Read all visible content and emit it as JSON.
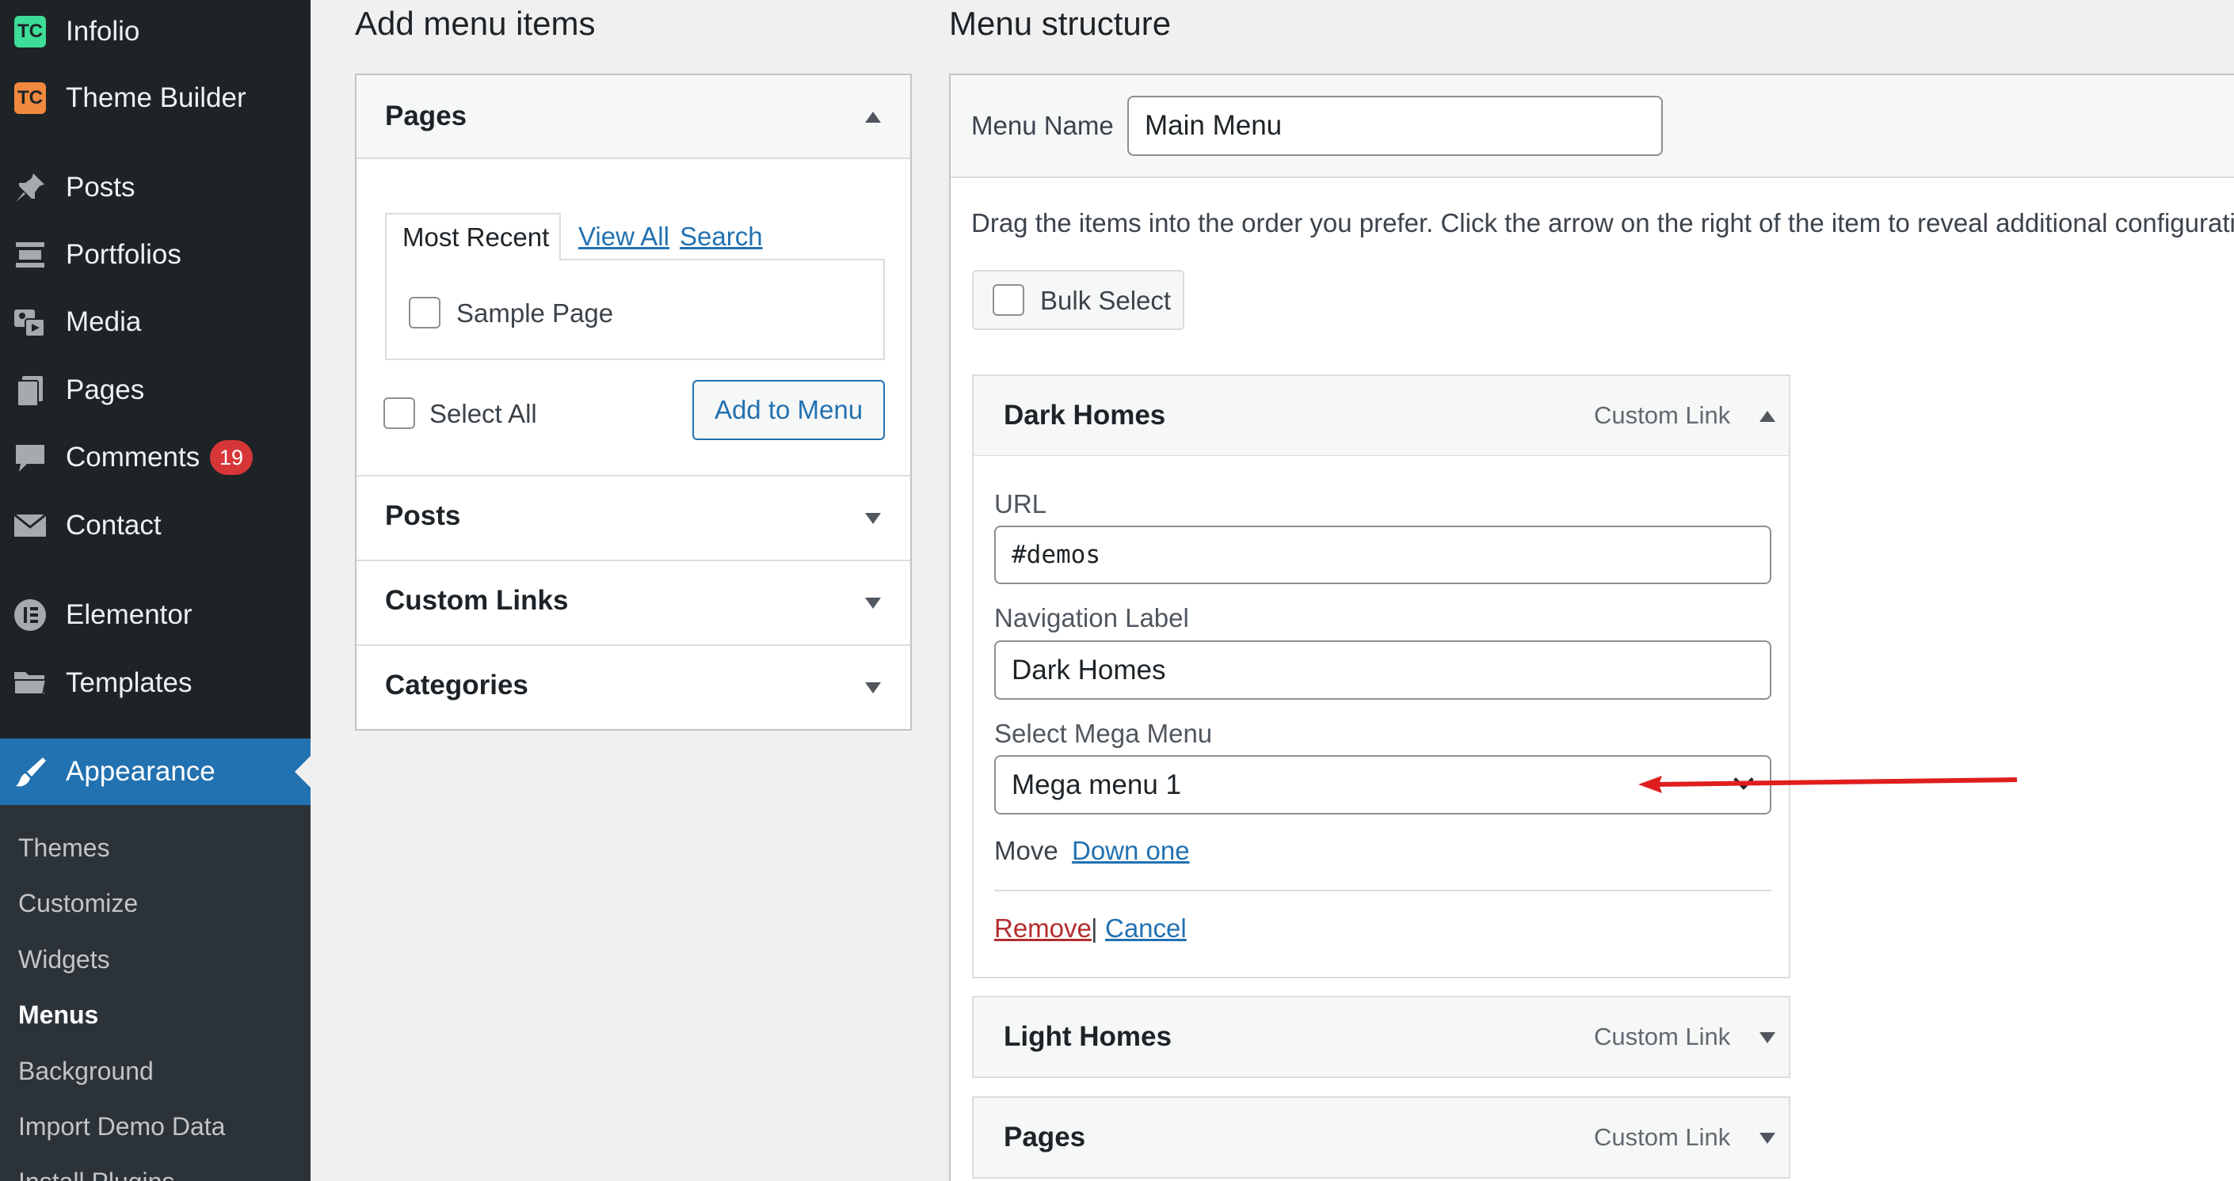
{
  "sidebar": {
    "top_items": [
      {
        "label": "Infolio",
        "icon": "tc-infolio-icon",
        "badge_text": "TC",
        "badge_color": "#3ddc97"
      },
      {
        "label": "Theme Builder",
        "icon": "tc-theme-builder-icon",
        "badge_text": "TC",
        "badge_color": "#f0883e"
      }
    ],
    "items": [
      {
        "label": "Posts",
        "icon": "pin-icon"
      },
      {
        "label": "Portfolios",
        "icon": "portfolio-icon"
      },
      {
        "label": "Media",
        "icon": "media-icon"
      },
      {
        "label": "Pages",
        "icon": "pages-icon"
      },
      {
        "label": "Comments",
        "icon": "comments-icon",
        "count": "19"
      },
      {
        "label": "Contact",
        "icon": "envelope-icon"
      },
      {
        "label": "Elementor",
        "icon": "elementor-icon"
      },
      {
        "label": "Templates",
        "icon": "folder-icon"
      }
    ],
    "active_item": {
      "label": "Appearance",
      "icon": "paintbrush-icon"
    },
    "submenu": [
      {
        "label": "Themes"
      },
      {
        "label": "Customize"
      },
      {
        "label": "Widgets"
      },
      {
        "label": "Menus",
        "current": true
      },
      {
        "label": "Background"
      },
      {
        "label": "Import Demo Data"
      },
      {
        "label": "Install Plugins"
      }
    ]
  },
  "add_menu_items": {
    "heading": "Add menu items",
    "pages_section": {
      "title": "Pages",
      "tabs": [
        {
          "label": "Most Recent",
          "active": true
        },
        {
          "label": "View All"
        },
        {
          "label": "Search"
        }
      ],
      "items": [
        {
          "label": "Sample Page",
          "checked": false
        }
      ],
      "select_all_label": "Select All",
      "add_button_label": "Add to Menu"
    },
    "collapsed_sections": [
      {
        "title": "Posts"
      },
      {
        "title": "Custom Links"
      },
      {
        "title": "Categories"
      }
    ]
  },
  "menu_structure": {
    "heading": "Menu structure",
    "menu_name_label": "Menu Name",
    "menu_name_value": "Main Menu",
    "instructions": "Drag the items into the order you prefer. Click the arrow on the right of the item to reveal additional configurati",
    "bulk_select_label": "Bulk Select",
    "items": [
      {
        "title": "Dark Homes",
        "type": "Custom Link",
        "expanded": true,
        "url_label": "URL",
        "url_value": "#demos",
        "nav_label_label": "Navigation Label",
        "nav_label_value": "Dark Homes",
        "mega_menu_label": "Select Mega Menu",
        "mega_menu_value": "Mega menu 1",
        "move_label": "Move",
        "move_link": "Down one",
        "remove_label": "Remove",
        "separator": "|",
        "cancel_label": "Cancel"
      },
      {
        "title": "Light Homes",
        "type": "Custom Link",
        "expanded": false
      },
      {
        "title": "Pages",
        "type": "Custom Link",
        "expanded": false
      }
    ]
  },
  "colors": {
    "sidebar_bg": "#1d2327",
    "accent": "#2271b1",
    "annotation_arrow": "#e01e1e",
    "badge": "#d63638"
  }
}
